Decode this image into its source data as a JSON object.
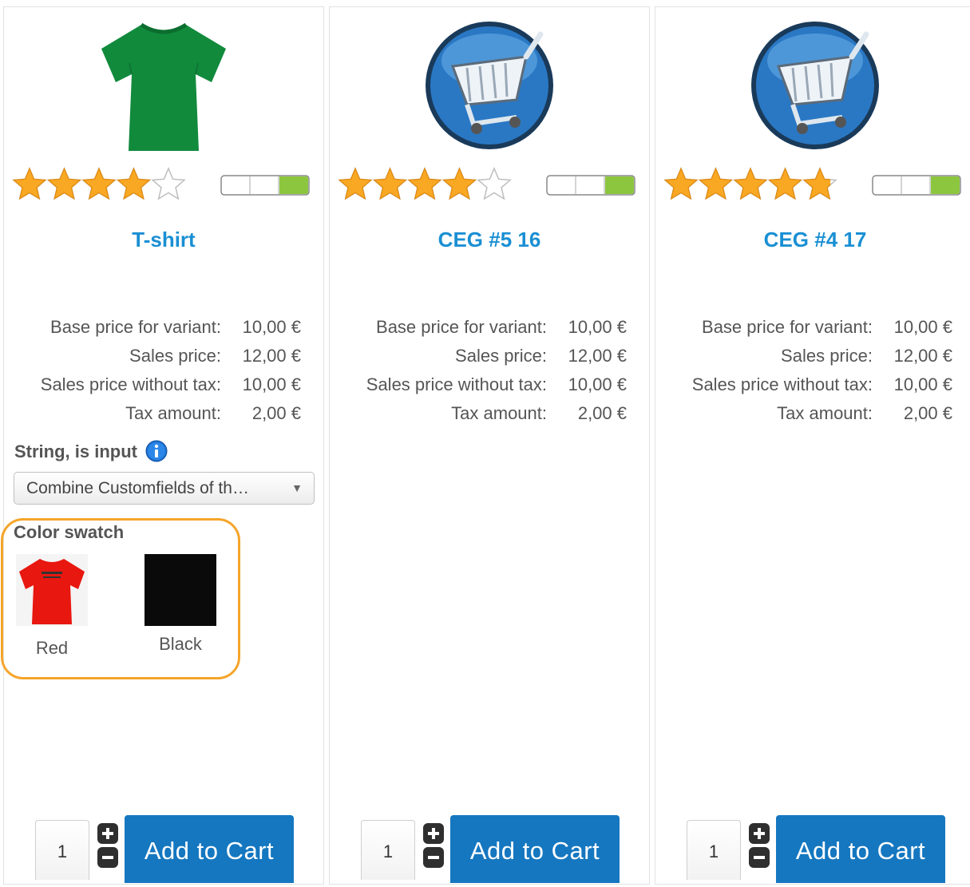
{
  "colors": {
    "title": "#1a8fd3",
    "button": "#1577c0",
    "highlight": "#f5a52a",
    "star": "#f9a823",
    "stock_level": "#8cc63f"
  },
  "products": [
    {
      "image_icon": "green-tshirt-image",
      "title": "T-shirt",
      "rating": 4,
      "rating_max": 5,
      "stock_level_segments": 1,
      "prices": [
        {
          "label": "Base price for variant:",
          "value": "10,00 €"
        },
        {
          "label": "Sales price:",
          "value": "12,00 €"
        },
        {
          "label": "Sales price without tax:",
          "value": "10,00 €"
        },
        {
          "label": "Tax amount:",
          "value": "2,00 €"
        }
      ],
      "custom_field_label": "String, is input",
      "dropdown_value": "Combine Customfields of th…",
      "swatch_label": "Color swatch",
      "swatches": [
        {
          "label": "Red",
          "color": "#e8170f"
        },
        {
          "label": "Black",
          "color": "#0a0a0a"
        }
      ],
      "quantity": "1",
      "cart_label": "Add to Cart"
    },
    {
      "image_icon": "shopping-cart-image",
      "title": "CEG #5 16",
      "rating": 4,
      "rating_max": 5,
      "stock_level_segments": 1,
      "prices": [
        {
          "label": "Base price for variant:",
          "value": "10,00 €"
        },
        {
          "label": "Sales price:",
          "value": "12,00 €"
        },
        {
          "label": "Sales price without tax:",
          "value": "10,00 €"
        },
        {
          "label": "Tax amount:",
          "value": "2,00 €"
        }
      ],
      "quantity": "1",
      "cart_label": "Add to Cart"
    },
    {
      "image_icon": "shopping-cart-image",
      "title": "CEG #4 17",
      "rating": 4.8,
      "rating_max": 5,
      "stock_level_segments": 1,
      "prices": [
        {
          "label": "Base price for variant:",
          "value": "10,00 €"
        },
        {
          "label": "Sales price:",
          "value": "12,00 €"
        },
        {
          "label": "Sales price without tax:",
          "value": "10,00 €"
        },
        {
          "label": "Tax amount:",
          "value": "2,00 €"
        }
      ],
      "quantity": "1",
      "cart_label": "Add to Cart"
    }
  ]
}
